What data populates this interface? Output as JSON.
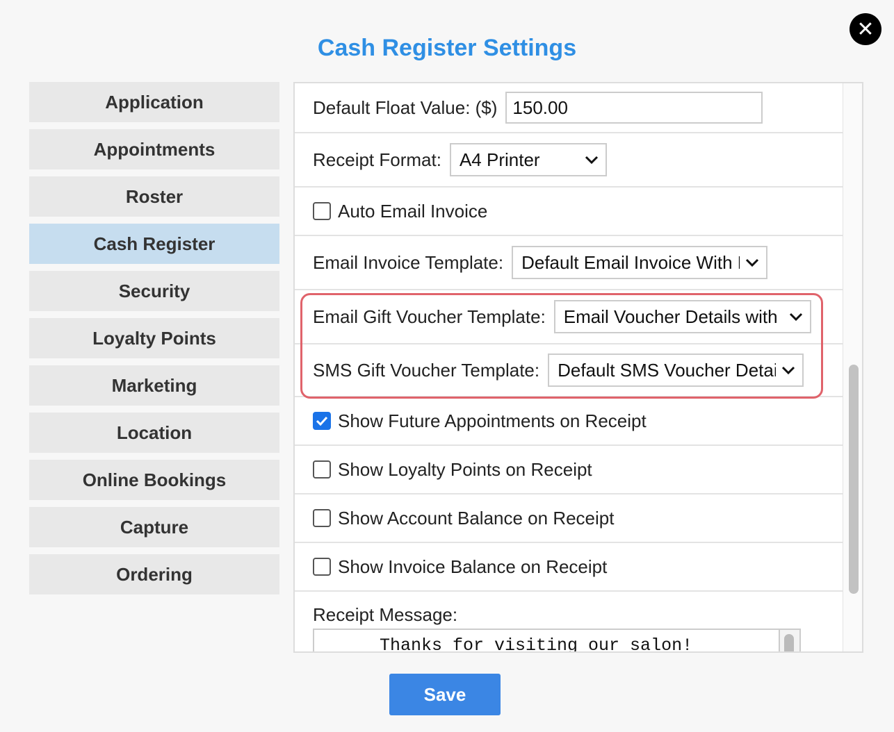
{
  "dialog": {
    "title": "Cash Register Settings",
    "close_icon": "close-icon",
    "save_label": "Save"
  },
  "sidebar": {
    "items": [
      {
        "label": "Application"
      },
      {
        "label": "Appointments"
      },
      {
        "label": "Roster"
      },
      {
        "label": "Cash Register",
        "active": true
      },
      {
        "label": "Security"
      },
      {
        "label": "Loyalty Points"
      },
      {
        "label": "Marketing"
      },
      {
        "label": "Location"
      },
      {
        "label": "Online Bookings"
      },
      {
        "label": "Capture"
      },
      {
        "label": "Ordering"
      }
    ]
  },
  "settings": {
    "default_float": {
      "label": "Default Float Value: ($)",
      "value": "150.00"
    },
    "receipt_format": {
      "label": "Receipt Format:",
      "selected": "A4 Printer"
    },
    "auto_email_invoice": {
      "label": "Auto Email Invoice",
      "checked": false
    },
    "email_invoice_template": {
      "label": "Email Invoice Template:",
      "selected": "Default Email Invoice With Payments"
    },
    "email_gift_voucher_template": {
      "label": "Email Gift Voucher Template:",
      "selected": "Email Voucher Details with Image"
    },
    "sms_gift_voucher_template": {
      "label": "SMS Gift Voucher Template:",
      "selected": "Default SMS Voucher Details"
    },
    "show_future_appointments": {
      "label": "Show Future Appointments on Receipt",
      "checked": true
    },
    "show_loyalty_points": {
      "label": "Show Loyalty Points on Receipt",
      "checked": false
    },
    "show_account_balance": {
      "label": "Show Account Balance on Receipt",
      "checked": false
    },
    "show_invoice_balance": {
      "label": "Show Invoice Balance on Receipt",
      "checked": false
    },
    "receipt_message": {
      "label": "Receipt Message:",
      "value": "Thanks for visiting our salon!"
    }
  },
  "colors": {
    "accent": "#2f8fe4",
    "active_nav": "#c6ddef",
    "highlight_border": "#e0636b",
    "save_button": "#3b86e4"
  }
}
